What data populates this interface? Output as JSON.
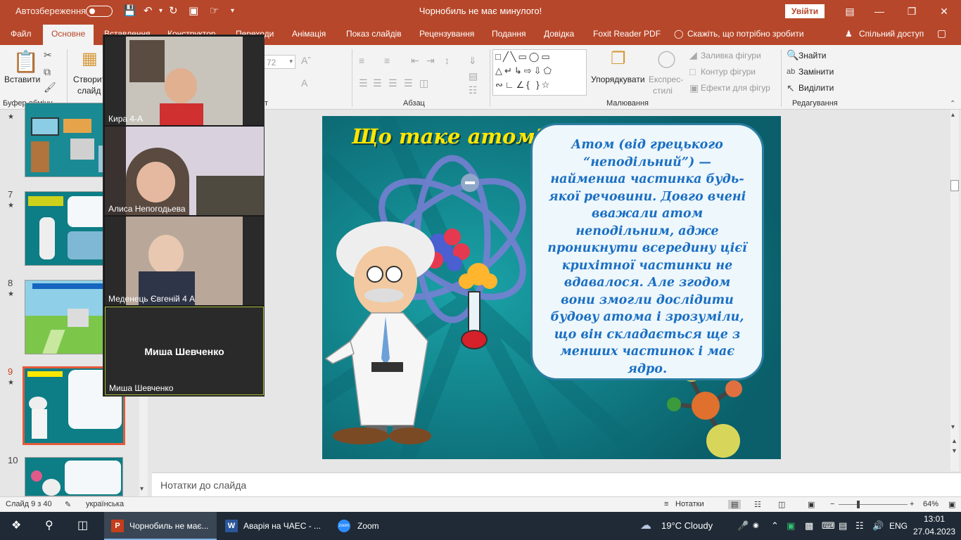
{
  "titlebar": {
    "autosave_label": "Автозбереження",
    "doc_title": "Чорнобиль не має минулого!",
    "signin_label": "Увійти"
  },
  "tabs": {
    "file": "Файл",
    "home": "Основне",
    "insert": "Вставлення",
    "design": "Конструктор",
    "transitions": "Переходи",
    "animation": "Анімація",
    "slideshow": "Показ слайдів",
    "review": "Рецензування",
    "view": "Подання",
    "help": "Довідка",
    "foxit": "Foxit Reader PDF",
    "tell_me": "Скажіть, що потрібно зробити",
    "share": "Спільний доступ"
  },
  "ribbon": {
    "paste": "Вставити",
    "clipboard": "Буфер обміну",
    "new_slide_1": "Створити",
    "new_slide_2": "слайд",
    "font_size": "72",
    "paragraph": "Абзац",
    "font_group": "т",
    "drawing": "Малювання",
    "arrange": "Упорядкувати",
    "styles_1": "Експрес-",
    "styles_2": "стилі",
    "fill": "Заливка фігури",
    "outline": "Контур фігури",
    "effects": "Ефекти для фігур",
    "find": "Знайти",
    "replace": "Замінити",
    "select": "Виділити",
    "editing": "Редагування"
  },
  "thumbnails": [
    {
      "num": "",
      "star": "★"
    },
    {
      "num": "7",
      "star": "★"
    },
    {
      "num": "8",
      "star": "★"
    },
    {
      "num": "9",
      "star": "★"
    },
    {
      "num": "10",
      "star": ""
    }
  ],
  "zoom": {
    "participants": [
      {
        "name": "Кира 4-А"
      },
      {
        "name": "Алиса Непогодьева"
      },
      {
        "name": "Меденець Євгеній 4 А"
      },
      {
        "name": "Миша Шевченко",
        "center_label": "Миша Шевченко"
      }
    ]
  },
  "slide": {
    "title": "Що таке атом?",
    "text": "Атом (від грецького “неподільний”) — найменша частинка будь-якої речовини. Довго вчені вважали атом неподільним, адже проникнути всередину цієї крихітної частинки не вдавалося. Але згодом вони змогли дослідити будову атома і зрозуміли, що він складається ще з менших частинок і має ядро."
  },
  "notes_placeholder": "Нотатки до слайда",
  "statusbar": {
    "slide_count": "Слайд 9 з 40",
    "language": "українська",
    "notes": "Нотатки",
    "zoom_pct": "64%"
  },
  "taskbar": {
    "apps": [
      {
        "label": "Чорнобиль не має..."
      },
      {
        "label": "Аварія на ЧАЕС - ..."
      },
      {
        "label": "Zoom"
      }
    ],
    "weather": "19°C  Cloudy",
    "lang": "ENG",
    "time": "13:01",
    "date": "27.04.2023"
  },
  "colors": {
    "accent": "#b7472a",
    "slide_bg": "#0d7d86",
    "title_yellow": "#ffe600",
    "text_blue": "#1a6fc4"
  }
}
